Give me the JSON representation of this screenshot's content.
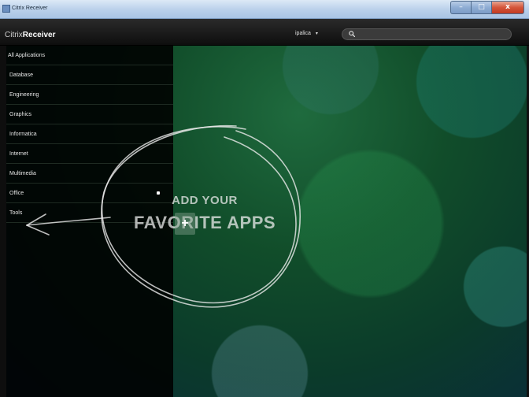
{
  "window": {
    "title": "Citrix Receiver",
    "controls": {
      "minimize": "–",
      "maximize": "□",
      "close": "x"
    }
  },
  "header": {
    "brand_prefix": "Citrix",
    "brand_name": "Receiver",
    "user_name": "ipalica",
    "search_placeholder": ""
  },
  "sidebar": {
    "items": [
      {
        "label": "All Applications"
      },
      {
        "label": "Database"
      },
      {
        "label": "Engineering"
      },
      {
        "label": "Graphics"
      },
      {
        "label": "Informatica"
      },
      {
        "label": "Internet"
      },
      {
        "label": "Multimedia"
      },
      {
        "label": "Office"
      },
      {
        "label": "Tools"
      }
    ]
  },
  "main": {
    "cta_line1": "ADD YOUR",
    "cta_line2": "FAVORITE APPS",
    "add_button": "+"
  },
  "colors": {
    "header_bg": "#141414",
    "sidebar_bg": "#050505",
    "background_green": "#114d2a",
    "background_teal": "#0a2a3c"
  }
}
